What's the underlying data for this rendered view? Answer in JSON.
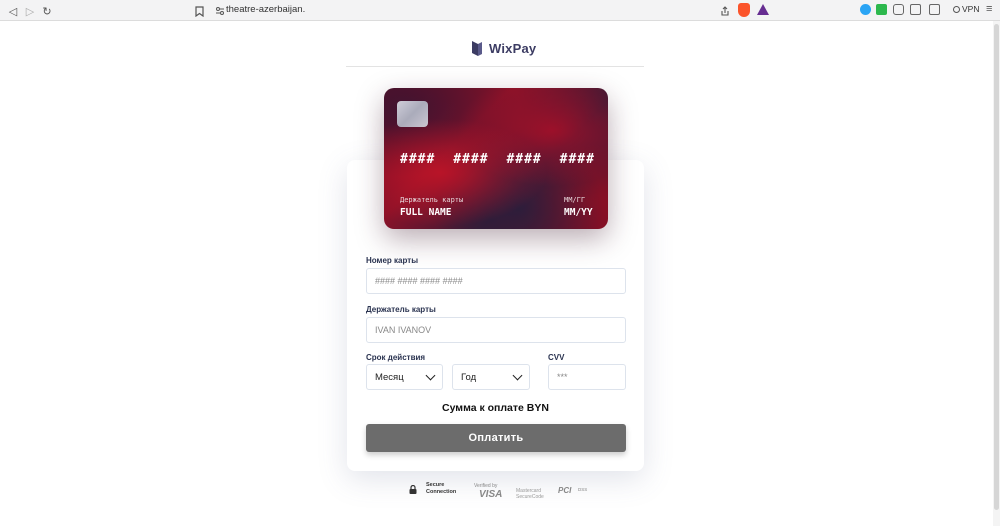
{
  "browser": {
    "url": "theatre-azerbaijan.",
    "vpn_label": "VPN"
  },
  "logo": {
    "name": "WixPay"
  },
  "card_preview": {
    "number_groups": [
      "####",
      "####",
      "####",
      "####"
    ],
    "holder_label": "Держатель карты",
    "holder_value": "FULL NAME",
    "expiry_label": "ММ/ГГ",
    "expiry_value": "MM/YY"
  },
  "form": {
    "card_number": {
      "label": "Номер карты",
      "placeholder": "#### #### #### ####"
    },
    "card_holder": {
      "label": "Держатель карты",
      "placeholder": "IVAN IVANOV"
    },
    "expiry": {
      "label": "Срок действия",
      "month_value": "Месяц",
      "year_value": "Год"
    },
    "cvv": {
      "label": "CVV",
      "placeholder": "***"
    },
    "amount_text": "Сумма к оплате BYN",
    "pay_button": "Оплатить"
  },
  "footer": {
    "secure_line1": "Secure",
    "secure_line2": "Connection",
    "visa_verified": "Verified by",
    "visa_brand": "VISA",
    "mc_line1": "Mastercard",
    "mc_line2": "SecureCode",
    "pci_brand": "PCI",
    "pci_small": "DSS"
  },
  "colors": {
    "button": "#6c6c6c",
    "logo_text": "#3c3c63",
    "label_text": "#2a3350"
  }
}
